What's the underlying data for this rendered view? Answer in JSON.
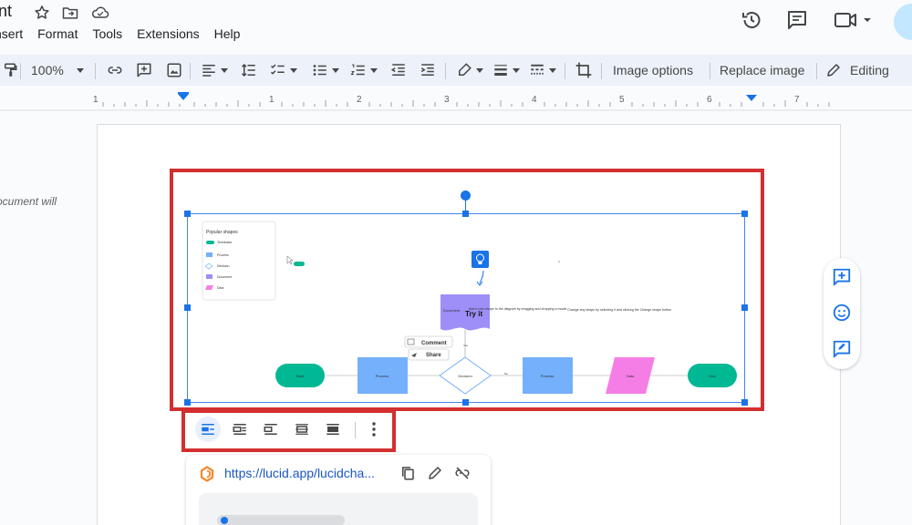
{
  "header": {
    "title": "nt",
    "menus": [
      "nsert",
      "Format",
      "Tools",
      "Extensions",
      "Help"
    ]
  },
  "toolbar": {
    "zoom": "100%",
    "image_options": "Image options",
    "replace_image": "Replace image",
    "editing": "Editing"
  },
  "ruler": {
    "numbers": [
      "1",
      "1",
      "2",
      "3",
      "4",
      "5",
      "6",
      "7"
    ]
  },
  "page": {
    "side_note": "ocument will"
  },
  "diagram": {
    "legend_title": "Popular shapes",
    "legend_items": [
      "Terminator",
      "Process",
      "Decision",
      "Document",
      "Data"
    ],
    "labels": {
      "start": "Start",
      "process1": "Process",
      "decision": "Decision",
      "process2": "Process",
      "data": "Data",
      "end": "End",
      "document": "Document",
      "try_it": "Try it",
      "yes": "Yes",
      "no": "No",
      "tip1": "Add a new shape to the diagram by dragging and dropping a model",
      "tip2": "Change any shape by selecting it and clicking the Change shape button",
      "comment": "Comment",
      "share": "Share"
    }
  },
  "link_card": {
    "url": "https://lucid.app/lucidcha..."
  },
  "colors": {
    "accent_blue": "#1a73e8",
    "highlight_red": "#d32f2f",
    "toolbar_bg": "#edf2fa",
    "terminator_green": "#00b894",
    "process_blue": "#74b0fb",
    "data_pink": "#f57ee6",
    "document_purple": "#9d8ef8"
  }
}
